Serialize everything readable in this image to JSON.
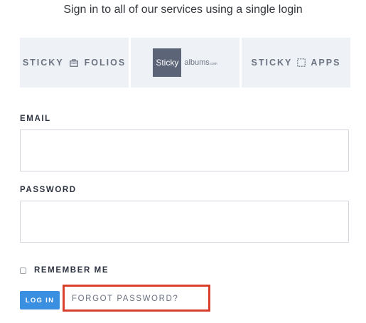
{
  "header": {
    "subtitle": "Sign in to all of our services using a single login"
  },
  "services": [
    {
      "name_part1": "STICKY",
      "name_part2": "FOLIOS",
      "icon": "briefcase-icon"
    },
    {
      "box_text": "Sticky",
      "side_text": "albums",
      "suffix": ".com"
    },
    {
      "name_part1": "STICKY",
      "name_part2": "APPS",
      "icon": "dashed-square-icon"
    }
  ],
  "form": {
    "email_label": "EMAIL",
    "email_value": "",
    "password_label": "PASSWORD",
    "password_value": "",
    "remember_label": "REMEMBER ME",
    "remember_checked": false,
    "login_label": "LOG IN",
    "forgot_label": "FORGOT PASSWORD?"
  },
  "colors": {
    "accent": "#3a8fe0",
    "highlight": "#d9402c",
    "service_bg": "#eef1f5",
    "albums_box": "#5c6478"
  }
}
